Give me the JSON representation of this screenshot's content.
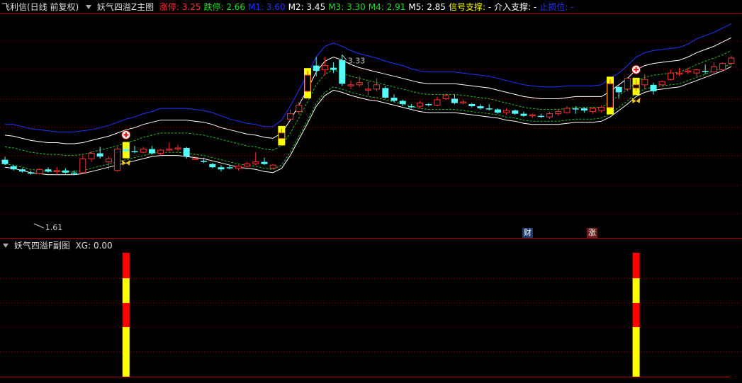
{
  "main_header": {
    "stock_title": "飞利信(日线 前复权)",
    "indicator_name": "妖气四溢Z主图",
    "items": [
      {
        "label": "涨停:",
        "value": "3.25",
        "color": "#ff3030"
      },
      {
        "label": "跌停:",
        "value": "2.66",
        "color": "#22dd22"
      },
      {
        "label": "M1:",
        "value": "3.60",
        "color": "#2233ff"
      },
      {
        "label": "M2:",
        "value": "3.45",
        "color": "#ffffff"
      },
      {
        "label": "M3:",
        "value": "3.30",
        "color": "#22dd22"
      },
      {
        "label": "M4:",
        "value": "2.91",
        "color": "#22dd22"
      },
      {
        "label": "M5:",
        "value": "2.85",
        "color": "#ffffff"
      },
      {
        "label": "信号支撑:",
        "value": "-",
        "color": "#ffff00"
      },
      {
        "label": "介入支撑:",
        "value": "-",
        "color": "#ffffff"
      },
      {
        "label": "止损位:",
        "value": "-",
        "color": "#2233ff"
      }
    ]
  },
  "sub_header": {
    "indicator_name": "妖气四溢F副图",
    "value_text": "XG: 0.00"
  },
  "tags": {
    "cai": "财",
    "zhang": "涨"
  },
  "colors": {
    "up": "#ff3232",
    "down": "#54fcfc",
    "grid": "#8b0000",
    "signal_yellow": "#ffff00",
    "signal_red": "#ff0000"
  },
  "chart_data": {
    "type": "candlestick",
    "max_label": "3.33",
    "min_label": "1.61",
    "ohlc": [
      [
        2.24,
        2.27,
        2.19,
        2.2
      ],
      [
        2.18,
        2.19,
        2.14,
        2.15
      ],
      [
        2.15,
        2.16,
        2.12,
        2.13
      ],
      [
        2.12,
        2.14,
        2.1,
        2.11
      ],
      [
        2.11,
        2.16,
        2.1,
        2.15
      ],
      [
        2.15,
        2.17,
        2.12,
        2.13
      ],
      [
        2.13,
        2.17,
        2.1,
        2.14
      ],
      [
        2.14,
        2.16,
        2.11,
        2.12
      ],
      [
        2.12,
        2.14,
        2.1,
        2.11
      ],
      [
        2.12,
        2.28,
        2.11,
        2.25
      ],
      [
        2.25,
        2.32,
        2.22,
        2.3
      ],
      [
        2.3,
        2.36,
        2.25,
        2.27
      ],
      [
        2.22,
        2.27,
        2.15,
        2.25
      ],
      [
        2.14,
        2.36,
        2.13,
        2.34
      ],
      [
        2.34,
        2.38,
        2.3,
        2.32
      ],
      [
        2.32,
        2.37,
        2.3,
        2.31
      ],
      [
        2.31,
        2.36,
        2.3,
        2.34
      ],
      [
        2.34,
        2.37,
        2.29,
        2.3
      ],
      [
        2.3,
        2.34,
        2.28,
        2.33
      ],
      [
        2.33,
        2.4,
        2.32,
        2.34
      ],
      [
        2.34,
        2.38,
        2.32,
        2.35
      ],
      [
        2.35,
        2.36,
        2.25,
        2.27
      ],
      [
        2.25,
        2.27,
        2.24,
        2.25
      ],
      [
        2.23,
        2.26,
        2.21,
        2.22
      ],
      [
        2.2,
        2.21,
        2.16,
        2.17
      ],
      [
        2.17,
        2.19,
        2.13,
        2.15
      ],
      [
        2.17,
        2.19,
        2.15,
        2.16
      ],
      [
        2.16,
        2.19,
        2.14,
        2.18
      ],
      [
        2.18,
        2.22,
        2.17,
        2.2
      ],
      [
        2.2,
        2.31,
        2.19,
        2.22
      ],
      [
        2.22,
        2.26,
        2.19,
        2.2
      ],
      [
        2.16,
        2.2,
        2.15,
        2.19
      ],
      [
        2.44,
        2.53,
        2.44,
        2.49
      ],
      [
        2.62,
        2.71,
        2.61,
        2.67
      ],
      [
        2.69,
        2.78,
        2.66,
        2.75
      ],
      [
        2.88,
        3.07,
        2.87,
        3.03
      ],
      [
        3.12,
        3.2,
        3.02,
        3.07
      ],
      [
        3.08,
        3.2,
        3.03,
        3.12
      ],
      [
        3.1,
        3.15,
        3.05,
        3.08
      ],
      [
        3.17,
        3.22,
        2.93,
        2.95
      ],
      [
        2.93,
        2.98,
        2.9,
        2.94
      ],
      [
        2.94,
        3.02,
        2.92,
        2.96
      ],
      [
        2.89,
        2.97,
        2.84,
        2.9
      ],
      [
        2.9,
        3.0,
        2.88,
        2.94
      ],
      [
        2.91,
        2.93,
        2.81,
        2.82
      ],
      [
        2.82,
        2.85,
        2.78,
        2.79
      ],
      [
        2.79,
        2.8,
        2.74,
        2.76
      ],
      [
        2.74,
        2.76,
        2.72,
        2.73
      ],
      [
        2.74,
        2.79,
        2.72,
        2.77
      ],
      [
        2.76,
        2.77,
        2.74,
        2.75
      ],
      [
        2.75,
        2.83,
        2.74,
        2.8
      ],
      [
        2.81,
        2.86,
        2.8,
        2.84
      ],
      [
        2.81,
        2.85,
        2.76,
        2.77
      ],
      [
        2.77,
        2.8,
        2.76,
        2.78
      ],
      [
        2.76,
        2.77,
        2.73,
        2.74
      ],
      [
        2.74,
        2.76,
        2.71,
        2.72
      ],
      [
        2.72,
        2.76,
        2.7,
        2.71
      ],
      [
        2.71,
        2.72,
        2.67,
        2.68
      ],
      [
        2.68,
        2.72,
        2.66,
        2.7
      ],
      [
        2.7,
        2.71,
        2.66,
        2.67
      ],
      [
        2.67,
        2.69,
        2.64,
        2.65
      ],
      [
        2.65,
        2.67,
        2.63,
        2.66
      ],
      [
        2.65,
        2.67,
        2.63,
        2.64
      ],
      [
        2.64,
        2.69,
        2.62,
        2.67
      ],
      [
        2.67,
        2.71,
        2.65,
        2.69
      ],
      [
        2.68,
        2.74,
        2.67,
        2.72
      ],
      [
        2.72,
        2.74,
        2.67,
        2.71
      ],
      [
        2.72,
        2.73,
        2.68,
        2.7
      ],
      [
        2.69,
        2.73,
        2.67,
        2.72
      ],
      [
        2.7,
        2.75,
        2.68,
        2.73
      ],
      [
        2.73,
        2.99,
        2.72,
        2.95
      ],
      [
        2.92,
        2.93,
        2.81,
        2.87
      ],
      [
        2.9,
        3.01,
        2.88,
        3.0
      ],
      [
        2.91,
        2.99,
        2.88,
        2.94
      ],
      [
        2.94,
        3.04,
        2.9,
        2.99
      ],
      [
        2.94,
        2.96,
        2.85,
        2.88
      ],
      [
        2.94,
        2.98,
        2.93,
        2.97
      ],
      [
        2.99,
        3.08,
        2.98,
        3.05
      ],
      [
        3.04,
        3.1,
        3.02,
        3.05
      ],
      [
        3.06,
        3.1,
        3.04,
        3.07
      ],
      [
        3.05,
        3.09,
        3.02,
        3.08
      ],
      [
        3.07,
        3.13,
        3.04,
        3.06
      ],
      [
        3.06,
        3.15,
        3.04,
        3.11
      ],
      [
        3.08,
        3.15,
        3.07,
        3.14
      ],
      [
        3.14,
        3.21,
        3.12,
        3.19
      ]
    ],
    "signal_indices": [
      14,
      73
    ],
    "band_bars": [
      14,
      32,
      35,
      70,
      73
    ],
    "lines": {
      "M1": [
        2.57,
        2.57,
        2.55,
        2.53,
        2.52,
        2.51,
        2.5,
        2.5,
        2.5,
        2.51,
        2.52,
        2.54,
        2.56,
        2.59,
        2.62,
        2.64,
        2.67,
        2.69,
        2.72,
        2.72,
        2.72,
        2.72,
        2.71,
        2.7,
        2.68,
        2.65,
        2.62,
        2.6,
        2.58,
        2.57,
        2.55,
        2.55,
        2.61,
        2.74,
        2.89,
        3.04,
        3.2,
        3.3,
        3.33,
        3.3,
        3.26,
        3.23,
        3.21,
        3.19,
        3.16,
        3.14,
        3.12,
        3.09,
        3.07,
        3.06,
        3.06,
        3.06,
        3.06,
        3.05,
        3.04,
        3.03,
        3.02,
        3.0,
        2.98,
        2.96,
        2.94,
        2.93,
        2.92,
        2.92,
        2.92,
        2.93,
        2.93,
        2.93,
        2.93,
        2.94,
        3.0,
        3.05,
        3.12,
        3.2,
        3.24,
        3.26,
        3.27,
        3.28,
        3.29,
        3.32,
        3.37,
        3.4,
        3.43,
        3.47,
        3.51
      ],
      "M2": [
        2.47,
        2.46,
        2.44,
        2.42,
        2.41,
        2.4,
        2.4,
        2.39,
        2.39,
        2.4,
        2.42,
        2.44,
        2.46,
        2.49,
        2.52,
        2.54,
        2.57,
        2.59,
        2.61,
        2.61,
        2.61,
        2.61,
        2.6,
        2.59,
        2.57,
        2.54,
        2.52,
        2.5,
        2.48,
        2.47,
        2.45,
        2.44,
        2.49,
        2.61,
        2.75,
        2.9,
        3.06,
        3.16,
        3.2,
        3.17,
        3.13,
        3.1,
        3.08,
        3.06,
        3.04,
        3.02,
        3.0,
        2.98,
        2.96,
        2.95,
        2.95,
        2.95,
        2.95,
        2.94,
        2.93,
        2.92,
        2.91,
        2.89,
        2.87,
        2.85,
        2.83,
        2.82,
        2.81,
        2.81,
        2.81,
        2.82,
        2.83,
        2.83,
        2.83,
        2.83,
        2.88,
        2.94,
        3.0,
        3.08,
        3.12,
        3.14,
        3.15,
        3.16,
        3.17,
        3.2,
        3.24,
        3.27,
        3.3,
        3.34,
        3.38
      ],
      "M3": [
        2.36,
        2.35,
        2.33,
        2.31,
        2.3,
        2.29,
        2.29,
        2.28,
        2.28,
        2.29,
        2.31,
        2.33,
        2.35,
        2.37,
        2.4,
        2.42,
        2.45,
        2.47,
        2.49,
        2.49,
        2.49,
        2.49,
        2.48,
        2.47,
        2.45,
        2.43,
        2.41,
        2.39,
        2.37,
        2.36,
        2.34,
        2.33,
        2.37,
        2.49,
        2.63,
        2.78,
        2.94,
        3.04,
        3.08,
        3.05,
        3.02,
        3.0,
        2.98,
        2.96,
        2.94,
        2.92,
        2.9,
        2.88,
        2.86,
        2.85,
        2.85,
        2.85,
        2.85,
        2.84,
        2.83,
        2.82,
        2.81,
        2.79,
        2.77,
        2.75,
        2.73,
        2.72,
        2.71,
        2.71,
        2.71,
        2.72,
        2.73,
        2.73,
        2.73,
        2.73,
        2.78,
        2.84,
        2.9,
        2.97,
        3.01,
        3.03,
        3.04,
        3.05,
        3.06,
        3.09,
        3.13,
        3.16,
        3.19,
        3.22,
        3.26
      ],
      "M4": [
        2.2,
        2.19,
        2.17,
        2.15,
        2.14,
        2.13,
        2.13,
        2.13,
        2.13,
        2.14,
        2.16,
        2.18,
        2.2,
        2.22,
        2.24,
        2.26,
        2.28,
        2.3,
        2.31,
        2.31,
        2.31,
        2.3,
        2.29,
        2.28,
        2.26,
        2.24,
        2.22,
        2.2,
        2.19,
        2.18,
        2.16,
        2.15,
        2.19,
        2.31,
        2.46,
        2.61,
        2.77,
        2.87,
        2.92,
        2.9,
        2.87,
        2.85,
        2.83,
        2.82,
        2.8,
        2.78,
        2.76,
        2.74,
        2.72,
        2.71,
        2.71,
        2.71,
        2.71,
        2.7,
        2.69,
        2.68,
        2.67,
        2.66,
        2.64,
        2.63,
        2.61,
        2.6,
        2.6,
        2.6,
        2.6,
        2.61,
        2.62,
        2.62,
        2.62,
        2.63,
        2.67,
        2.73,
        2.79,
        2.86,
        2.9,
        2.92,
        2.93,
        2.94,
        2.95,
        2.98,
        3.01,
        3.04,
        3.07,
        3.1,
        3.14
      ],
      "M5": [
        2.17,
        2.16,
        2.14,
        2.12,
        2.11,
        2.1,
        2.1,
        2.1,
        2.1,
        2.11,
        2.13,
        2.15,
        2.17,
        2.19,
        2.21,
        2.23,
        2.25,
        2.27,
        2.28,
        2.28,
        2.28,
        2.27,
        2.26,
        2.25,
        2.23,
        2.21,
        2.19,
        2.17,
        2.16,
        2.15,
        2.13,
        2.12,
        2.16,
        2.28,
        2.43,
        2.58,
        2.74,
        2.84,
        2.89,
        2.87,
        2.84,
        2.82,
        2.8,
        2.79,
        2.77,
        2.75,
        2.73,
        2.71,
        2.69,
        2.68,
        2.68,
        2.68,
        2.68,
        2.67,
        2.66,
        2.65,
        2.64,
        2.63,
        2.61,
        2.6,
        2.58,
        2.57,
        2.57,
        2.57,
        2.57,
        2.58,
        2.59,
        2.59,
        2.59,
        2.6,
        2.64,
        2.7,
        2.76,
        2.83,
        2.87,
        2.89,
        2.9,
        2.91,
        2.92,
        2.95,
        2.98,
        3.01,
        3.04,
        3.07,
        3.11
      ]
    }
  }
}
